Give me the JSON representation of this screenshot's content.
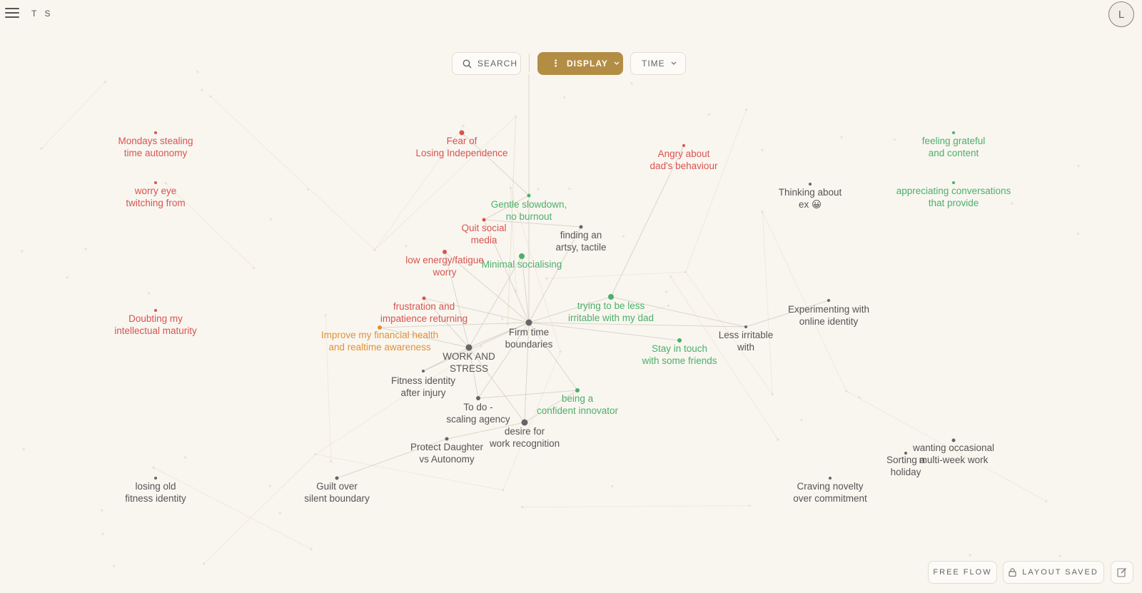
{
  "header": {
    "brand": "T S",
    "avatar_initial": "L"
  },
  "toolbar": {
    "search_label": "SEARCH",
    "display_label": "DISPLAY",
    "time_label": "TIME"
  },
  "footer": {
    "free_flow_label": "FREE FLOW",
    "layout_saved_label": "LAYOUT SAVED"
  },
  "colors": {
    "red": "#d9534f",
    "green": "#4caf6a",
    "orange": "#e0913a",
    "gray": "#555555",
    "accent": "#b48d45"
  },
  "nodes": [
    {
      "id": "mondays",
      "text": "Mondays stealing\ntime autonomy",
      "color": "red"
    },
    {
      "id": "fear",
      "text": "Fear of\nLosing Independence",
      "color": "red"
    },
    {
      "id": "angry",
      "text": "Angry about\ndad's behaviour",
      "color": "red"
    },
    {
      "id": "grateful",
      "text": "feeling grateful\nand content",
      "color": "green"
    },
    {
      "id": "worry-eye",
      "text": "worry eye\ntwitching from",
      "color": "red"
    },
    {
      "id": "thinking-ex",
      "text": "Thinking about\nex 😀",
      "color": "gray"
    },
    {
      "id": "appreciating",
      "text": "appreciating conversations\nthat provide",
      "color": "green"
    },
    {
      "id": "gentle",
      "text": "Gentle slowdown,\nno burnout",
      "color": "green"
    },
    {
      "id": "quit-social",
      "text": "Quit social\nmedia",
      "color": "red"
    },
    {
      "id": "artsy",
      "text": "finding an\nartsy, tactile",
      "color": "gray"
    },
    {
      "id": "low-energy",
      "text": "low energy/fatigue\nworry",
      "color": "red"
    },
    {
      "id": "min-social",
      "text": "Minimal socialising",
      "color": "green"
    },
    {
      "id": "frustration",
      "text": "frustration and\nimpatience returning",
      "color": "red"
    },
    {
      "id": "less-irritable-dad",
      "text": "trying to be less\nirritable with my dad",
      "color": "green"
    },
    {
      "id": "experimenting",
      "text": "Experimenting with\nonline identity",
      "color": "gray"
    },
    {
      "id": "doubting",
      "text": "Doubting my\nintellectual maturity",
      "color": "red"
    },
    {
      "id": "financial",
      "text": "Improve my financial health\nand realtime awareness",
      "color": "orange"
    },
    {
      "id": "firm-time",
      "text": "Firm time\nboundaries",
      "color": "gray"
    },
    {
      "id": "less-irritable",
      "text": "Less irritable\nwith",
      "color": "gray"
    },
    {
      "id": "stay-touch",
      "text": "Stay in touch\nwith some friends",
      "color": "green"
    },
    {
      "id": "work-stress",
      "text": "WORK AND\nSTRESS",
      "color": "gray"
    },
    {
      "id": "fitness-identity",
      "text": "Fitness identity\nafter injury",
      "color": "gray"
    },
    {
      "id": "confident",
      "text": "being a\nconfident innovator",
      "color": "green"
    },
    {
      "id": "todo",
      "text": "To do -\nscaling agency",
      "color": "gray"
    },
    {
      "id": "recognition",
      "text": "desire for\nwork recognition",
      "color": "gray"
    },
    {
      "id": "protect-daughter",
      "text": "Protect Daughter\nvs Autonomy",
      "color": "gray"
    },
    {
      "id": "wanting-holiday",
      "text": "wanting occasional\nmulti-week work",
      "color": "gray"
    },
    {
      "id": "sorting",
      "text": "Sorting a\nholiday",
      "color": "gray"
    },
    {
      "id": "losing-fitness",
      "text": "losing old\nfitness identity",
      "color": "gray"
    },
    {
      "id": "guilt",
      "text": "Guilt over\nsilent boundary",
      "color": "gray"
    },
    {
      "id": "craving",
      "text": "Craving novelty\nover commitment",
      "color": "gray"
    }
  ]
}
